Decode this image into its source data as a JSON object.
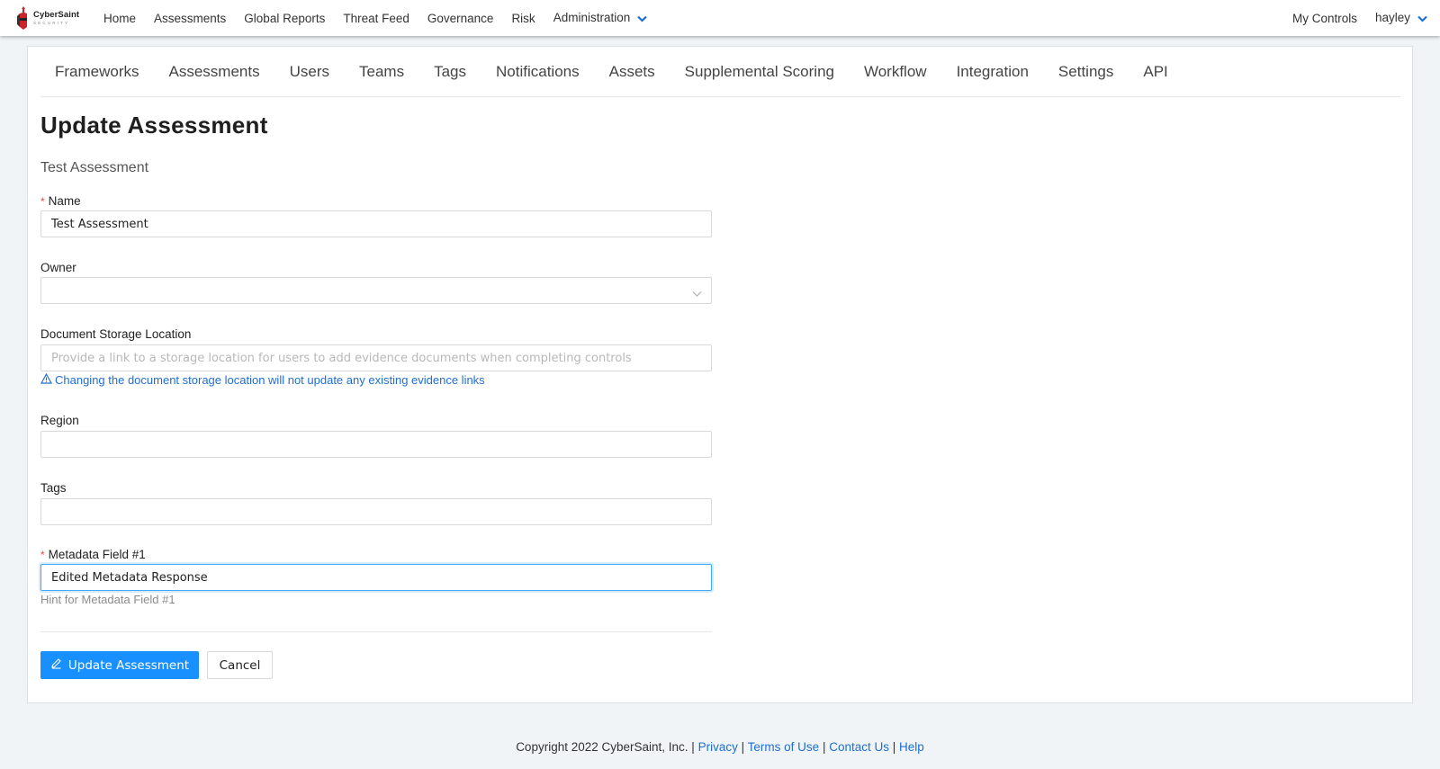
{
  "brand": {
    "name": "CyberSaint",
    "sub": "SECURITY"
  },
  "topnav": {
    "items": [
      "Home",
      "Assessments",
      "Global Reports",
      "Threat Feed",
      "Governance",
      "Risk",
      "Administration"
    ],
    "right": [
      "My Controls",
      "hayley"
    ]
  },
  "tabs": [
    "Frameworks",
    "Assessments",
    "Users",
    "Teams",
    "Tags",
    "Notifications",
    "Assets",
    "Supplemental Scoring",
    "Workflow",
    "Integration",
    "Settings",
    "API"
  ],
  "page": {
    "title": "Update Assessment",
    "subtitle": "Test Assessment"
  },
  "form": {
    "name": {
      "label": "Name",
      "value": "Test Assessment",
      "required": true
    },
    "owner": {
      "label": "Owner",
      "value": ""
    },
    "doc_storage": {
      "label": "Document Storage Location",
      "value": "",
      "placeholder": "Provide a link to a storage location for users to add evidence documents when completing controls",
      "warning": "Changing the document storage location will not update any existing evidence links"
    },
    "region": {
      "label": "Region",
      "value": ""
    },
    "tags": {
      "label": "Tags",
      "value": ""
    },
    "metadata1": {
      "label": "Metadata Field #1",
      "value": "Edited Metadata Response",
      "hint": "Hint for Metadata Field #1",
      "required": true
    },
    "update_label": "Update Assessment",
    "cancel_label": "Cancel"
  },
  "footer": {
    "copyright": "Copyright 2022 CyberSaint, Inc. |",
    "links": [
      "Privacy",
      "Terms of Use",
      "Contact Us",
      "Help"
    ],
    "sep": "|"
  },
  "colors": {
    "primary": "#1890ff",
    "link": "#1f6fd1",
    "required": "#e8474c",
    "brand_red": "#c8262c"
  },
  "icons": {
    "admin_chevron": "chevron-down-icon",
    "select_arrow": "chevron-down-icon",
    "warning": "warning-triangle-icon",
    "edit": "edit-icon"
  }
}
